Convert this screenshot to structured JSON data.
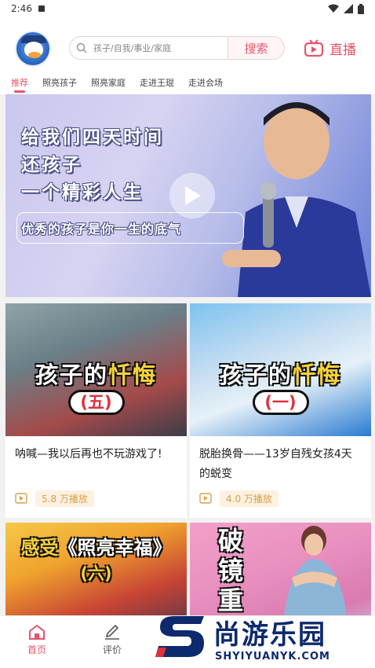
{
  "status_bar": {
    "time": "2:46"
  },
  "header": {
    "search_placeholder": "孩子/自我/事业/家庭",
    "search_button": "搜索",
    "live_label": "直播"
  },
  "tabs": [
    {
      "label": "推荐",
      "active": true
    },
    {
      "label": "照亮孩子",
      "active": false
    },
    {
      "label": "照亮家庭",
      "active": false
    },
    {
      "label": "走进王琨",
      "active": false
    },
    {
      "label": "走进会场",
      "active": false
    }
  ],
  "banner": {
    "lines": [
      "给我们四天时间",
      "还孩子",
      "一个精彩人生"
    ],
    "subtitle": "优秀的孩子是你一生的底气"
  },
  "cards": [
    {
      "thumb_title_a": "孩子的",
      "thumb_title_b": "忏悔",
      "thumb_badge": "(五)",
      "title": "呐喊—我以后再也不玩游戏了!",
      "views": "5.8 万播放"
    },
    {
      "thumb_title_a": "孩子的",
      "thumb_title_b": "忏悔",
      "thumb_badge": "(一)",
      "title": "脱胎换骨——13岁自残女孩4天的蜕变",
      "views": "4.0 万播放"
    },
    {
      "thumb_title_a": "感受",
      "thumb_title_b": "《照亮幸福》",
      "thumb_badge": "(六)"
    },
    {
      "thumb_vertical": "破镜重"
    }
  ],
  "bottom_nav": [
    {
      "label": "首页",
      "active": true
    },
    {
      "label": "评价",
      "active": false
    }
  ],
  "watermark": {
    "text": "尚游乐园",
    "url": "SHYIYUANYK.COM"
  },
  "colors": {
    "accent": "#e8546a",
    "views": "#d9a14a",
    "watermark": "#0d2a6e"
  },
  "icons": [
    "avatar-duck",
    "search-icon",
    "tv-live-icon",
    "play-icon",
    "video-icon",
    "home-icon",
    "edit-icon"
  ]
}
